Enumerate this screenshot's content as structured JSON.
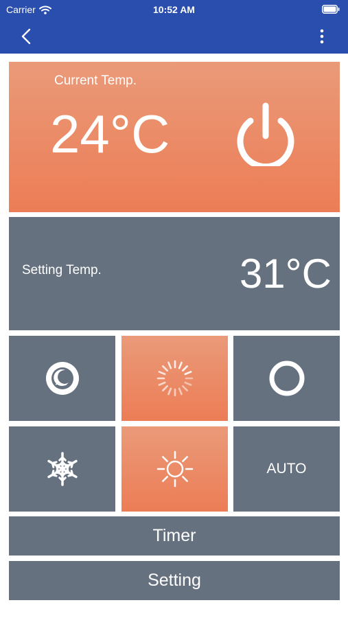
{
  "status_bar": {
    "carrier": "Carrier",
    "time": "10:52 AM"
  },
  "nav": {
    "back_icon": "chevron-left-icon",
    "more_icon": "more-vertical-icon"
  },
  "current": {
    "label": "Current Temp.",
    "value": "24°C",
    "power_icon": "power-icon"
  },
  "setting": {
    "label": "Setting Temp.",
    "value": "31°C"
  },
  "modes": {
    "sleep": {
      "icon": "sleep-moon-icon",
      "active": false
    },
    "fan_speed": {
      "icon": "fan-speed-icon",
      "active": true
    },
    "ring": {
      "icon": "ring-icon",
      "active": false
    },
    "cool": {
      "icon": "snowflake-icon",
      "active": false
    },
    "heat": {
      "icon": "sun-icon",
      "active": true
    },
    "auto": {
      "label": "AUTO",
      "active": false
    }
  },
  "buttons": {
    "timer": "Timer",
    "setting": "Setting"
  },
  "colors": {
    "header": "#2a4eae",
    "orange": "#ec7d56",
    "slate": "#66717f"
  }
}
